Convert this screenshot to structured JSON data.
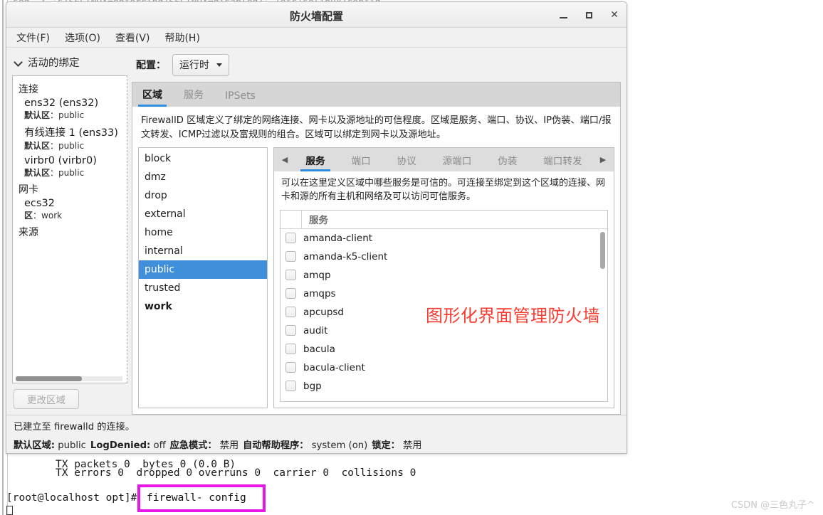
{
  "terminal": {
    "top_line": "sed -i 's/SELINUX=enforcing/SELINUX=disabled/' /etc/selinux/config",
    "line1": "TX packets 0  bytes 0 (0.0 B)",
    "line2": "TX errors 0  dropped 0 overruns 0  carrier 0  collisions 0",
    "prompt": "[root@localhost opt]#",
    "highlighted_command": "firewall- config",
    "watermark": "CSDN @三色丸子^"
  },
  "window": {
    "title": "防火墙配置",
    "controls": {
      "minimize": "—",
      "maximize": "□",
      "close": "✕"
    },
    "menu": [
      {
        "label": "文件(F)"
      },
      {
        "label": "选项(O)"
      },
      {
        "label": "查看(V)"
      },
      {
        "label": "帮助(H)"
      }
    ]
  },
  "sidebar": {
    "title": "活动的绑定",
    "groups": [
      {
        "name": "连接",
        "items": [
          {
            "name": "ens32 (ens32)",
            "sub_label": "默认区",
            "sub_value": "public"
          },
          {
            "name": "有线连接 1 (ens33)",
            "sub_label": "默认区",
            "sub_value": "public"
          },
          {
            "name": "virbr0 (virbr0)",
            "sub_label": "默认区",
            "sub_value": "public"
          }
        ]
      },
      {
        "name": "网卡",
        "items": [
          {
            "name": "ecs32",
            "sub_label": "区",
            "sub_value": "work"
          }
        ]
      },
      {
        "name": "来源",
        "items": []
      }
    ],
    "change_zone_button": "更改区域"
  },
  "config_row": {
    "label": "配置：",
    "selected": "运行时"
  },
  "outer_tabs": [
    {
      "label": "区域",
      "active": true
    },
    {
      "label": "服务",
      "active": false
    },
    {
      "label": "IPSets",
      "active": false
    }
  ],
  "zone_description": "FirewallD 区域定义了绑定的网络连接、网卡以及源地址的可信程度。区域是服务、端口、协议、IP伪装、端口/报文转发、ICMP过滤以及富规则的组合。区域可以绑定到网卡以及源地址。",
  "zones": [
    {
      "label": "block",
      "selected": false,
      "bold": false
    },
    {
      "label": "dmz",
      "selected": false,
      "bold": false
    },
    {
      "label": "drop",
      "selected": false,
      "bold": false
    },
    {
      "label": "external",
      "selected": false,
      "bold": false
    },
    {
      "label": "home",
      "selected": false,
      "bold": false
    },
    {
      "label": "internal",
      "selected": false,
      "bold": false
    },
    {
      "label": "public",
      "selected": true,
      "bold": false
    },
    {
      "label": "trusted",
      "selected": false,
      "bold": false
    },
    {
      "label": "work",
      "selected": false,
      "bold": true
    }
  ],
  "inner_tabs": {
    "prev_arrow": "◀",
    "next_arrow": "▶",
    "items": [
      {
        "label": "服务",
        "active": true
      },
      {
        "label": "端口",
        "active": false
      },
      {
        "label": "协议",
        "active": false
      },
      {
        "label": "源端口",
        "active": false
      },
      {
        "label": "伪装",
        "active": false
      },
      {
        "label": "端口转发",
        "active": false
      }
    ]
  },
  "services_description": "可以在这里定义区域中哪些服务是可信的。可连接至绑定到这个区域的连接、网卡和源的所有主机和网络及可以访问可信服务。",
  "services_table": {
    "header": "服务",
    "rows": [
      {
        "label": "amanda-client",
        "checked": false
      },
      {
        "label": "amanda-k5-client",
        "checked": false
      },
      {
        "label": "amqp",
        "checked": false
      },
      {
        "label": "amqps",
        "checked": false
      },
      {
        "label": "apcupsd",
        "checked": false
      },
      {
        "label": "audit",
        "checked": false
      },
      {
        "label": "bacula",
        "checked": false
      },
      {
        "label": "bacula-client",
        "checked": false
      },
      {
        "label": "bgp",
        "checked": false
      }
    ]
  },
  "annotation": {
    "text": "图形化界面管理防火墙",
    "color": "#fb3b30"
  },
  "statusbar": {
    "connection": "已建立至 firewalld 的连接。",
    "fields": [
      {
        "label": "默认区域:",
        "value": "public"
      },
      {
        "label": "LogDenied:",
        "value": "off"
      },
      {
        "label": "应急模式：",
        "value": "禁用"
      },
      {
        "label": "自动帮助程序：",
        "value": "system (on)"
      },
      {
        "label": "锁定：",
        "value": "禁用"
      }
    ]
  },
  "colors": {
    "accent": "#2d8ce0",
    "selection": "#3f8fda",
    "annotation_red": "#fb3b30",
    "highlight_magenta": "#e816e8"
  }
}
